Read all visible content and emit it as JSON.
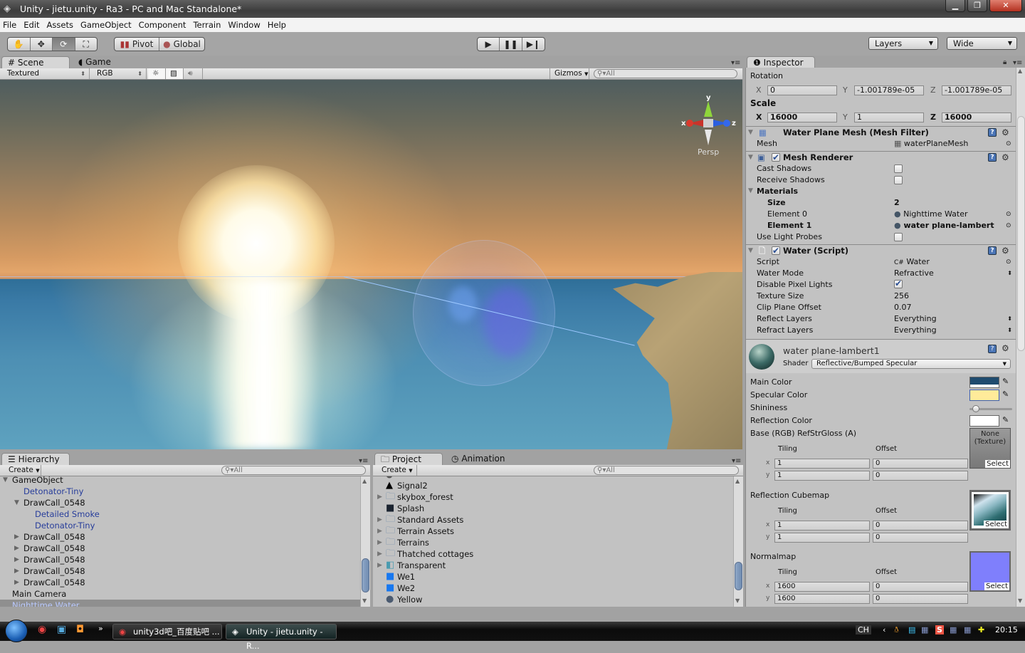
{
  "window": {
    "title": "Unity - jietu.unity - Ra3 - PC and Mac Standalone*",
    "controls": [
      "minimize",
      "restore",
      "close"
    ]
  },
  "menu": [
    "File",
    "Edit",
    "Assets",
    "GameObject",
    "Component",
    "Terrain",
    "Window",
    "Help"
  ],
  "toolbar": {
    "tools": [
      {
        "name": "hand-tool",
        "icon": "hand-icon"
      },
      {
        "name": "move-tool",
        "icon": "move-arrows-icon"
      },
      {
        "name": "rotate-tool",
        "icon": "rotate-icon",
        "active": true
      },
      {
        "name": "scale-tool",
        "icon": "scale-icon"
      }
    ],
    "pivot_label": "Pivot",
    "global_label": "Global",
    "play": "play-icon",
    "pause": "pause-icon",
    "step": "step-icon",
    "layers_label": "Layers",
    "layout_label": "Wide"
  },
  "scene_panel": {
    "tabs": [
      {
        "label": "Scene",
        "icon": "grid-icon",
        "active": true
      },
      {
        "label": "Game",
        "icon": "pacman-icon"
      }
    ],
    "render_mode": "Textured",
    "color_mode": "RGB",
    "gizmos_label": "Gizmos",
    "search_placeholder": "All",
    "gizmo": {
      "x": "x",
      "y": "y",
      "z": "z",
      "projection": "Persp"
    }
  },
  "inspector": {
    "tab": "Inspector",
    "rotation": {
      "label": "Rotation",
      "x": "0",
      "y": "-1.001789e-05",
      "z": "-1.001789e-05"
    },
    "scale": {
      "label": "Scale",
      "x": "16000",
      "y": "1",
      "z": "16000"
    },
    "axis_labels": {
      "x": "X",
      "y": "Y",
      "z": "Z"
    },
    "mesh_filter": {
      "title": "Water Plane Mesh (Mesh Filter)",
      "mesh_label": "Mesh",
      "mesh_value": "waterPlaneMesh"
    },
    "mesh_renderer": {
      "title": "Mesh Renderer",
      "enabled": true,
      "cast_shadows": {
        "label": "Cast Shadows",
        "value": false
      },
      "receive_shadows": {
        "label": "Receive Shadows",
        "value": false
      },
      "materials_label": "Materials",
      "size_label": "Size",
      "size_value": "2",
      "element0_label": "Element 0",
      "element0_value": "Nighttime Water",
      "element1_label": "Element 1",
      "element1_value": "water plane-lambert",
      "light_probes": {
        "label": "Use Light Probes",
        "value": false
      }
    },
    "water_script": {
      "title": "Water (Script)",
      "enabled": true,
      "rows": [
        {
          "label": "Script",
          "value": "Water"
        },
        {
          "label": "Water Mode",
          "value": "Refractive"
        },
        {
          "label": "Disable Pixel Lights",
          "value": true
        },
        {
          "label": "Texture Size",
          "value": "256"
        },
        {
          "label": "Clip Plane Offset",
          "value": "0.07"
        },
        {
          "label": "Reflect Layers",
          "value": "Everything"
        },
        {
          "label": "Refract Layers",
          "value": "Everything"
        }
      ]
    },
    "material": {
      "name": "water plane-lambert1",
      "shader_label": "Shader",
      "shader_value": "Reflective/Bumped Specular",
      "main_color": {
        "label": "Main Color",
        "hex": "#1f4b6e"
      },
      "specular_color": {
        "label": "Specular Color",
        "hex": "#ffeb9a"
      },
      "shininess": {
        "label": "Shininess",
        "value": 0.15
      },
      "reflection_color": {
        "label": "Reflection Color",
        "hex": "#ffffff"
      },
      "base_tex": {
        "label": "Base (RGB) RefStrGloss (A)",
        "preview": "None (Texture)",
        "select": "Select",
        "tiling_label": "Tiling",
        "offset_label": "Offset",
        "tiling_x": "1",
        "tiling_y": "1",
        "offset_x": "0",
        "offset_y": "0"
      },
      "cubemap": {
        "label": "Reflection Cubemap",
        "select": "Select",
        "tiling_x": "1",
        "tiling_y": "1",
        "offset_x": "0",
        "offset_y": "0"
      },
      "normalmap": {
        "label": "Normalmap",
        "select": "Select",
        "tiling_x": "1600",
        "tiling_y": "1600",
        "offset_x": "0",
        "offset_y": "0"
      }
    }
  },
  "hierarchy": {
    "tab": "Hierarchy",
    "create": "Create",
    "search_placeholder": "All",
    "items": [
      {
        "label": "GameObject",
        "indent": 0,
        "arrow": "down",
        "style": "cut"
      },
      {
        "label": "Detonator-Tiny",
        "indent": 1,
        "style": "blue"
      },
      {
        "label": "DrawCall_0548",
        "indent": 1,
        "arrow": "down"
      },
      {
        "label": "Detailed Smoke",
        "indent": 2,
        "style": "blue"
      },
      {
        "label": "Detonator-Tiny",
        "indent": 2,
        "style": "blue"
      },
      {
        "label": "DrawCall_0548",
        "indent": 1,
        "arrow": "right"
      },
      {
        "label": "DrawCall_0548",
        "indent": 1,
        "arrow": "right"
      },
      {
        "label": "DrawCall_0548",
        "indent": 1,
        "arrow": "right"
      },
      {
        "label": "DrawCall_0548",
        "indent": 1,
        "arrow": "right"
      },
      {
        "label": "DrawCall_0548",
        "indent": 1,
        "arrow": "right"
      },
      {
        "label": "Main Camera",
        "indent": 0
      },
      {
        "label": "Nighttime Water",
        "indent": 0,
        "style": "selected"
      }
    ]
  },
  "project": {
    "tabs": [
      {
        "label": "Project",
        "active": true
      },
      {
        "label": "Animation"
      }
    ],
    "create": "Create",
    "search_placeholder": "All",
    "items": [
      {
        "label": "Signal2",
        "icon": "texture-icon",
        "arrow": ""
      },
      {
        "label": "skybox_forest",
        "icon": "folder-icon",
        "arrow": "right"
      },
      {
        "label": "Splash",
        "icon": "texture-icon",
        "arrow": ""
      },
      {
        "label": "Standard Assets",
        "icon": "folder-icon",
        "arrow": "right"
      },
      {
        "label": "Terrain Assets",
        "icon": "folder-icon",
        "arrow": "right"
      },
      {
        "label": "Terrains",
        "icon": "folder-icon",
        "arrow": "right"
      },
      {
        "label": "Thatched cottages",
        "icon": "folder-icon",
        "arrow": "right"
      },
      {
        "label": "Transparent",
        "icon": "prefab-icon",
        "arrow": "right"
      },
      {
        "label": "We1",
        "icon": "blue-texture-icon",
        "arrow": ""
      },
      {
        "label": "We2",
        "icon": "blue-texture-icon",
        "arrow": ""
      },
      {
        "label": "Yellow",
        "icon": "material-icon",
        "arrow": ""
      }
    ]
  },
  "taskbar": {
    "items": [
      "unity3d吧_百度贴吧 ...",
      "Unity - jietu.unity - R..."
    ],
    "lang": "CH",
    "time": "20:15"
  }
}
